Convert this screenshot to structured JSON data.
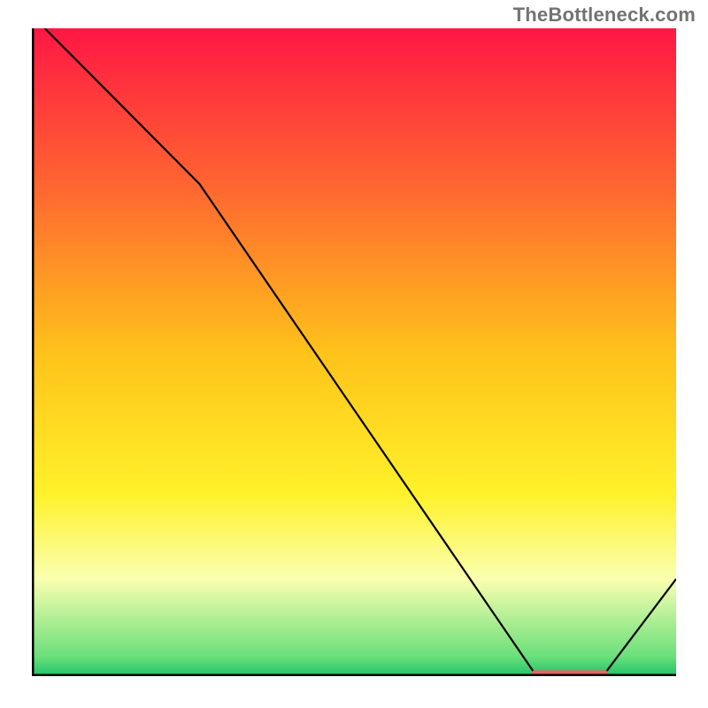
{
  "watermark": "TheBottleneck.com",
  "chart_data": {
    "type": "line",
    "title": "",
    "xlabel": "",
    "ylabel": "",
    "xlim": [
      0,
      100
    ],
    "ylim": [
      0,
      100
    ],
    "grid": false,
    "legend": false,
    "series": [
      {
        "name": "curve",
        "x": [
          2,
          26,
          78,
          89,
          100
        ],
        "y": [
          100,
          76,
          0.5,
          0.5,
          15
        ]
      }
    ],
    "highlight_segment": {
      "x": [
        78,
        89
      ],
      "y": [
        0.5,
        0.5
      ],
      "color": "#e06666"
    },
    "gradient_stops": [
      {
        "offset": 0.0,
        "color": "#ff1744"
      },
      {
        "offset": 0.25,
        "color": "#ff6830"
      },
      {
        "offset": 0.5,
        "color": "#ffc21a"
      },
      {
        "offset": 0.72,
        "color": "#fff22a"
      },
      {
        "offset": 0.85,
        "color": "#faffb0"
      },
      {
        "offset": 0.97,
        "color": "#6adf7a"
      },
      {
        "offset": 1.0,
        "color": "#1fc36a"
      }
    ],
    "axis_color": "#000000",
    "line_color": "#000000",
    "line_width": 2.2
  }
}
